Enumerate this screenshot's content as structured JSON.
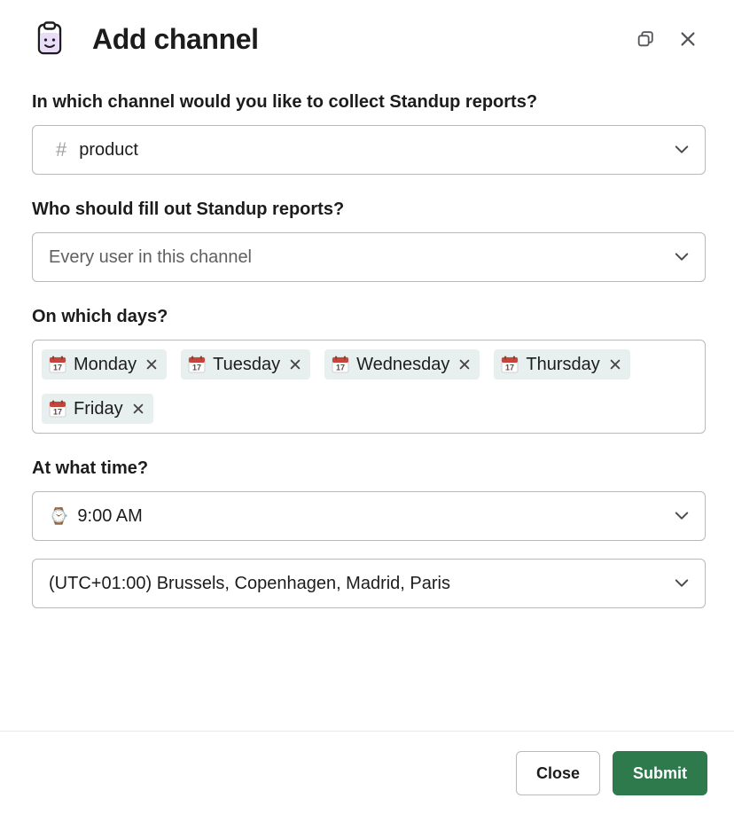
{
  "header": {
    "title": "Add channel"
  },
  "fields": {
    "channel": {
      "label": "In which channel would you like to collect Standup reports?",
      "value": "product"
    },
    "who": {
      "label": "Who should fill out Standup reports?",
      "value": "Every user in this channel"
    },
    "days": {
      "label": "On which days?",
      "items": [
        "Monday",
        "Tuesday",
        "Wednesday",
        "Thursday",
        "Friday"
      ]
    },
    "time": {
      "label": "At what time?",
      "value": "9:00 AM"
    },
    "tz": {
      "value": "(UTC+01:00) Brussels, Copenhagen, Madrid, Paris"
    }
  },
  "footer": {
    "close": "Close",
    "submit": "Submit"
  }
}
